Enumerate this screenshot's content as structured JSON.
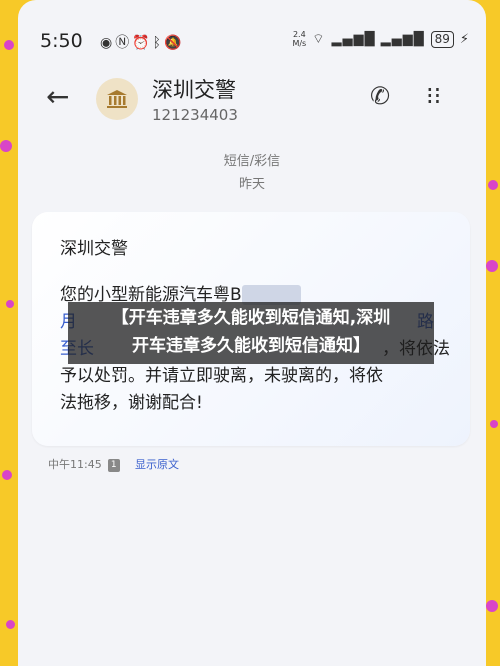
{
  "status_bar": {
    "time": "5:50",
    "icons_left": [
      "eye-icon",
      "nfc-icon",
      "alarm-icon",
      "bluetooth-icon",
      "mute-icon"
    ],
    "net_speed": "2.4",
    "net_unit": "M/s",
    "wifi": "⌔",
    "signal": "▂▄▆█ ▂▄▆█",
    "battery": "89",
    "charging": "⚡"
  },
  "header": {
    "back": "←",
    "title": "深圳交警",
    "number": "121234403",
    "call": "✆",
    "more": "⁝⁝"
  },
  "thread_meta": {
    "channel": "短信/彩信",
    "day": "昨天"
  },
  "message": {
    "sender": "深圳交警",
    "line1_prefix": "您的小型新能源汽车粤B",
    "line1_blur": "···········",
    "line2_prefix": "月",
    "line2_suffix": "路",
    "line3_prefix": "至长",
    "line3_suffix": "，将依法",
    "line4": "予以处罚。并请立即驶离，未驶离的，将依",
    "line5": "法拖移，谢谢配合!"
  },
  "footer": {
    "time": "中午11:45",
    "sim": "1",
    "show_original": "显示原文"
  },
  "overlay": {
    "line1": "【开车违章多久能收到短信通知,深圳",
    "line2": "开车违章多久能收到短信通知】"
  }
}
